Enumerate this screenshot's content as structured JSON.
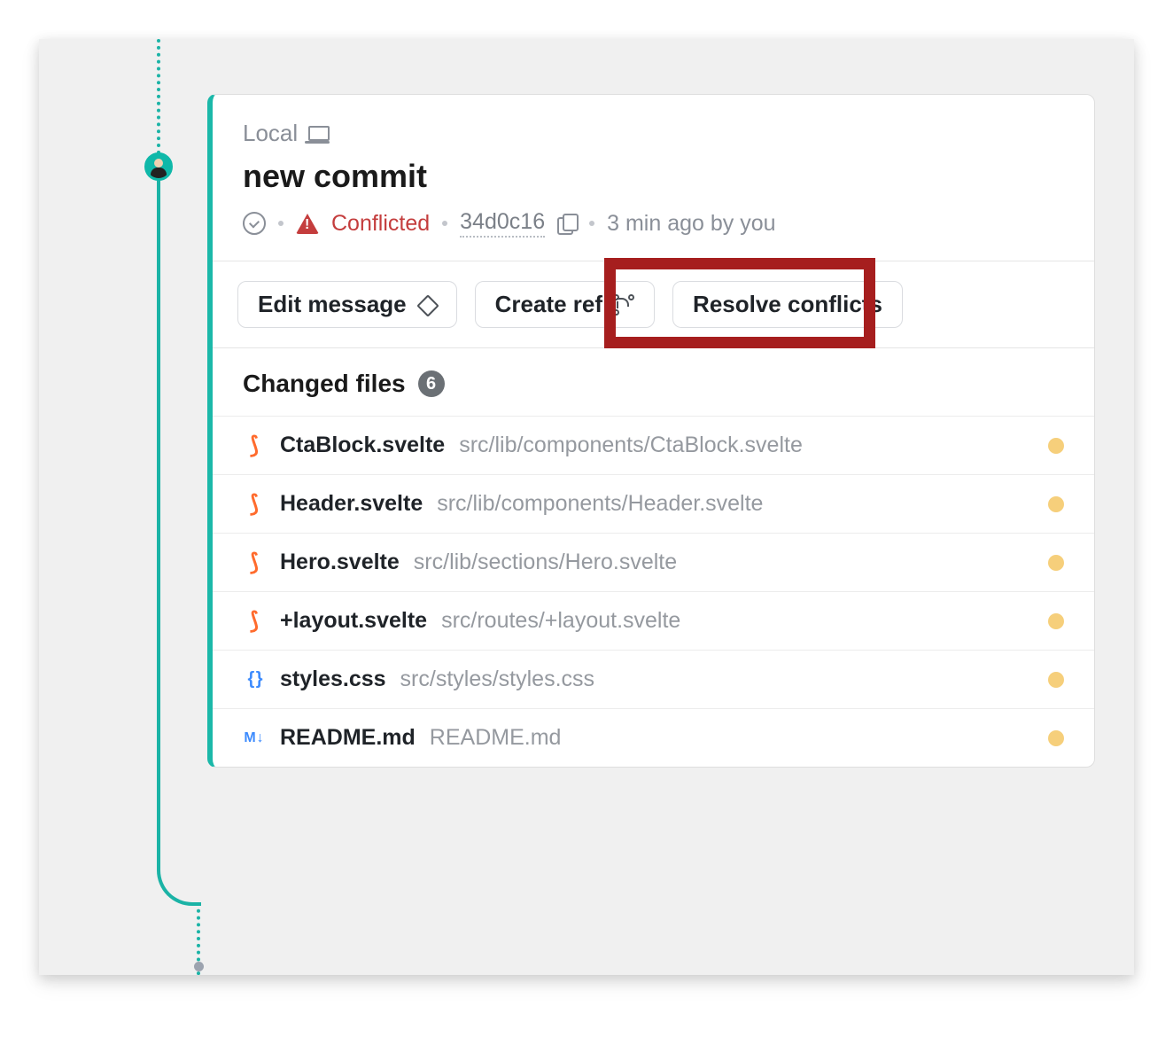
{
  "header": {
    "local_label": "Local",
    "commit_title": "new commit",
    "status": "Conflicted",
    "sha": "34d0c16",
    "timestamp": "3 min ago by you"
  },
  "actions": {
    "edit_message": "Edit message",
    "create_ref": "Create ref",
    "resolve_conflicts": "Resolve conflicts"
  },
  "files": {
    "heading": "Changed files",
    "count": "6",
    "items": [
      {
        "icon": "svelte",
        "name": "CtaBlock.svelte",
        "path": "src/lib/components/CtaBlock.svelte",
        "status": "modified"
      },
      {
        "icon": "svelte",
        "name": "Header.svelte",
        "path": "src/lib/components/Header.svelte",
        "status": "modified"
      },
      {
        "icon": "svelte",
        "name": "Hero.svelte",
        "path": "src/lib/sections/Hero.svelte",
        "status": "modified"
      },
      {
        "icon": "svelte",
        "name": "+layout.svelte",
        "path": "src/routes/+layout.svelte",
        "status": "modified"
      },
      {
        "icon": "css",
        "name": "styles.css",
        "path": "src/styles/styles.css",
        "status": "modified"
      },
      {
        "icon": "md",
        "name": "README.md",
        "path": "README.md",
        "status": "modified"
      }
    ]
  }
}
